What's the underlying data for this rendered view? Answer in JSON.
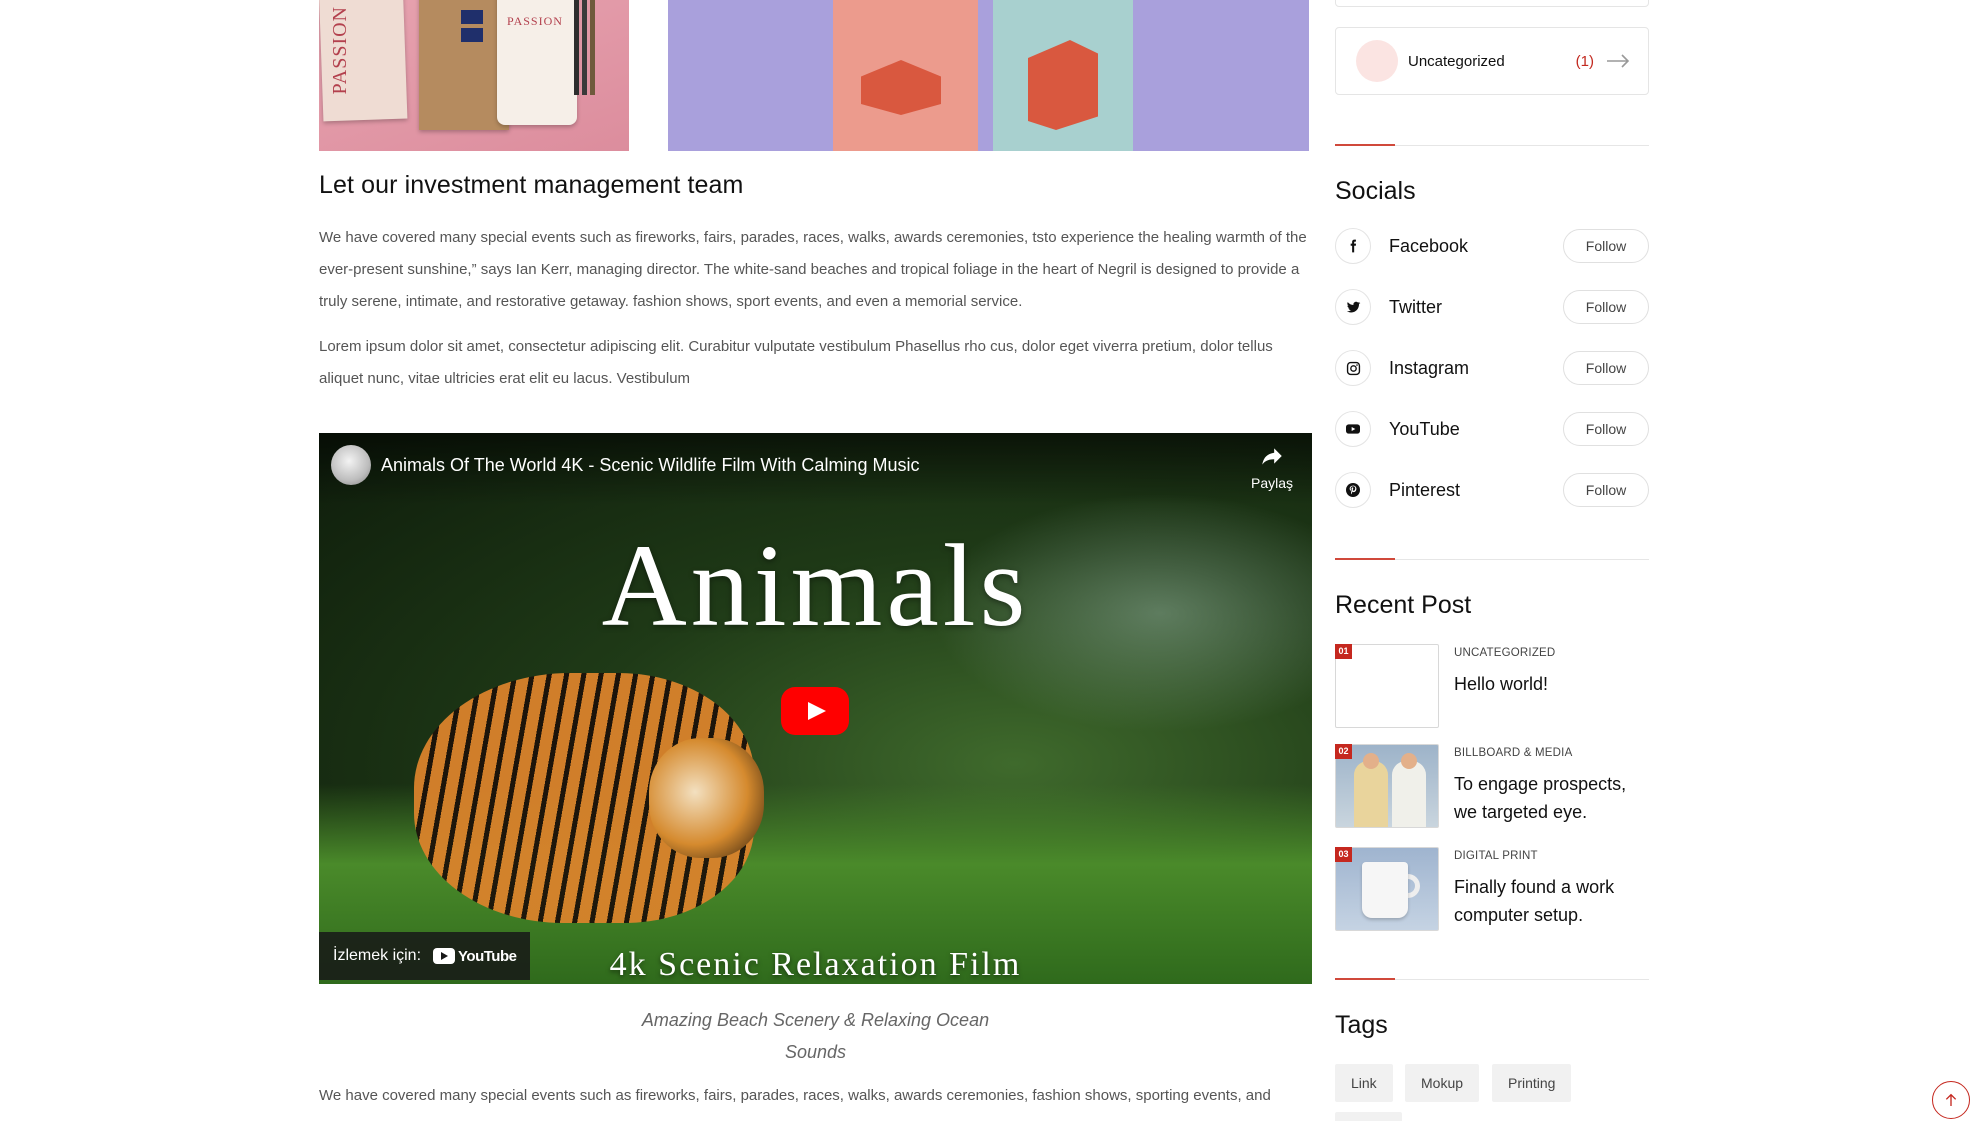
{
  "article": {
    "heading": "Let our investment management team",
    "paragraph_1": "We have covered many special events such as fireworks, fairs, parades, races, walks, awards ceremonies, tsto experience the healing warmth of the ever-present sunshine,” says Ian Kerr, managing director. The white-sand beaches and tropical foliage in the heart of Negril is designed to provide a truly serene, intimate, and restorative getaway. fashion shows, sport events, and even a memorial service.",
    "paragraph_2": "Lorem ipsum dolor sit amet, consectetur adipiscing elit. Curabitur vulputate vestibulum Phasellus rho cus, dolor eget viverra pretium, dolor tellus aliquet nunc, vitae ultricies erat elit eu lacus. Vestibulum",
    "paragraph_3": "We have covered many special events such as fireworks, fairs, parades, races, walks, awards ceremonies, fashion shows, sporting events, and",
    "image_text_1": "PASSION",
    "image_text_2": "PASSION",
    "video": {
      "title": "Animals Of The World 4K - Scenic Wildlife Film With Calming Music",
      "share_label": "Paylaş",
      "overlay_title": "Animals",
      "overlay_subtitle": "4k Scenic Relaxation Film",
      "watch_on_label": "İzlemek için:",
      "youtube_label": "YouTube"
    },
    "caption": "Amazing Beach Scenery & Relaxing Ocean Sounds"
  },
  "sidebar": {
    "category": {
      "name": "Uncategorized",
      "count": "(1)"
    },
    "socials_title": "Socials",
    "socials": [
      {
        "name": "Facebook",
        "icon": "facebook-icon",
        "button": "Follow"
      },
      {
        "name": "Twitter",
        "icon": "twitter-icon",
        "button": "Follow"
      },
      {
        "name": "Instagram",
        "icon": "instagram-icon",
        "button": "Follow"
      },
      {
        "name": "YouTube",
        "icon": "youtube-icon",
        "button": "Follow"
      },
      {
        "name": "Pinterest",
        "icon": "pinterest-icon",
        "button": "Follow"
      }
    ],
    "recent_title": "Recent Post",
    "recent_posts": [
      {
        "num": "01",
        "category": "UNCATEGORIZED",
        "title": "Hello world!"
      },
      {
        "num": "02",
        "category": "BILLBOARD & MEDIA",
        "title": "To engage prospects, we targeted eye."
      },
      {
        "num": "03",
        "category": "DIGITAL PRINT",
        "title": "Finally found a work computer setup."
      }
    ],
    "tags_title": "Tags",
    "tags": [
      "Link",
      "Mokup",
      "Printing"
    ]
  },
  "colors": {
    "accent": "#c5281f",
    "youtube_red": "#ff0000"
  }
}
